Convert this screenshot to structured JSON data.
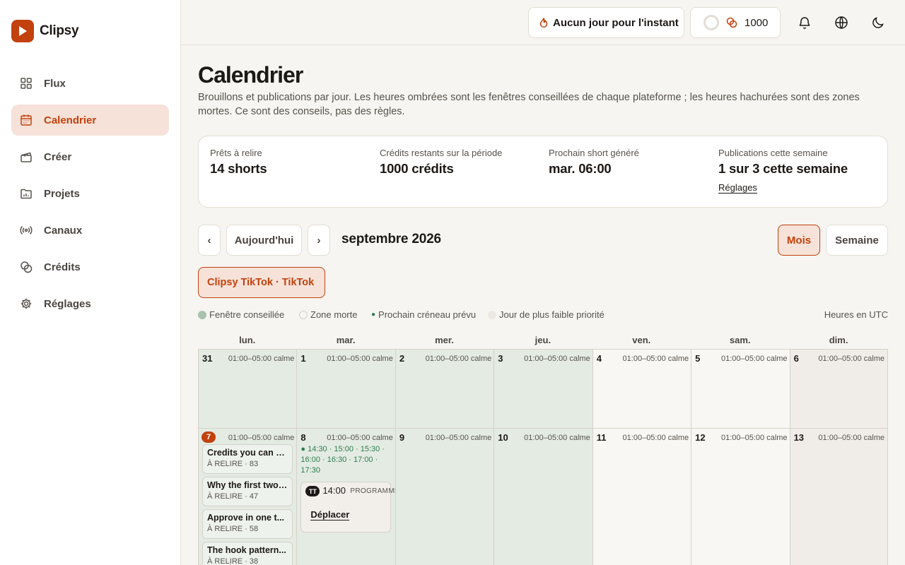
{
  "app": {
    "name": "Clipsy"
  },
  "sidebar": {
    "items": [
      {
        "label": "Flux",
        "icon": "grid-icon"
      },
      {
        "label": "Calendrier",
        "icon": "calendar-icon",
        "active": true
      },
      {
        "label": "Créer",
        "icon": "clapperboard-icon"
      },
      {
        "label": "Projets",
        "icon": "folder-chart-icon"
      },
      {
        "label": "Canaux",
        "icon": "broadcast-icon"
      },
      {
        "label": "Crédits",
        "icon": "coins-icon"
      },
      {
        "label": "Réglages",
        "icon": "gear-icon"
      }
    ]
  },
  "topbar": {
    "streak_label": "Aucun jour pour l'instant",
    "credits_value": "1000"
  },
  "page": {
    "title": "Calendrier",
    "subtitle": "Brouillons et publications par jour. Les heures ombrées sont les fenêtres conseillées de chaque plateforme ; les heures hachurées sont des zones mortes. Ce sont des conseils, pas des règles."
  },
  "stats": [
    {
      "label": "Prêts à relire",
      "value": "14 shorts"
    },
    {
      "label": "Crédits restants sur la période",
      "value": "1000 crédits"
    },
    {
      "label": "Prochain short généré",
      "value": "mar. 06:00"
    },
    {
      "label": "Publications cette semaine",
      "value": "1 sur 3 cette semaine",
      "link": "Réglages"
    }
  ],
  "calendar_nav": {
    "prev": "‹",
    "today": "Aujourd'hui",
    "next": "›",
    "month": "septembre 2026",
    "view_month": "Mois",
    "view_week": "Semaine"
  },
  "channel_chip": "Clipsy TikTok · TikTok",
  "legend": {
    "window": "Fenêtre conseillée",
    "dead": "Zone morte",
    "next_slot": "Prochain créneau prévu",
    "low_priority": "Jour de plus faible priorité",
    "timezone": "Heures en UTC"
  },
  "weekdays": [
    "lun.",
    "mar.",
    "mer.",
    "jeu.",
    "ven.",
    "sam.",
    "dim."
  ],
  "calm_label": "01:00–05:00 calme",
  "weeks": [
    {
      "days": [
        {
          "num": "31",
          "tone": "green"
        },
        {
          "num": "1",
          "tone": "green"
        },
        {
          "num": "2",
          "tone": "green"
        },
        {
          "num": "3",
          "tone": "green"
        },
        {
          "num": "4",
          "tone": "plain"
        },
        {
          "num": "5",
          "tone": "plain"
        },
        {
          "num": "6",
          "tone": "gray"
        }
      ]
    },
    {
      "days": [
        {
          "num": "7",
          "tone": "green",
          "today": true
        },
        {
          "num": "8",
          "tone": "green"
        },
        {
          "num": "9",
          "tone": "green"
        },
        {
          "num": "10",
          "tone": "green"
        },
        {
          "num": "11",
          "tone": "plain"
        },
        {
          "num": "12",
          "tone": "plain"
        },
        {
          "num": "13",
          "tone": "gray"
        }
      ]
    }
  ],
  "drafts": [
    {
      "title": "Credits you can s...",
      "meta": "À RELIRE · 83"
    },
    {
      "title": "Why the first two ...",
      "meta": "À RELIRE · 47"
    },
    {
      "title": "Approve in one t...",
      "meta": "À RELIRE · 58"
    },
    {
      "title": "The hook pattern...",
      "meta": "À RELIRE · 38"
    }
  ],
  "slots": "● 14:30 · 15:00 · 15:30 · 16:00 · 16:30 · 17:00 · 17:30",
  "scheduled": {
    "badge": "TT",
    "time": "14:00",
    "status": "PROGRAMMÉE",
    "action": "Déplacer"
  },
  "colors": {
    "accent": "#c2410c",
    "accent_soft": "#f6e2d8",
    "window_green": "#e3ebe3",
    "low_priority_gray": "#f0ede8",
    "slot_green": "#2f7d4e"
  }
}
